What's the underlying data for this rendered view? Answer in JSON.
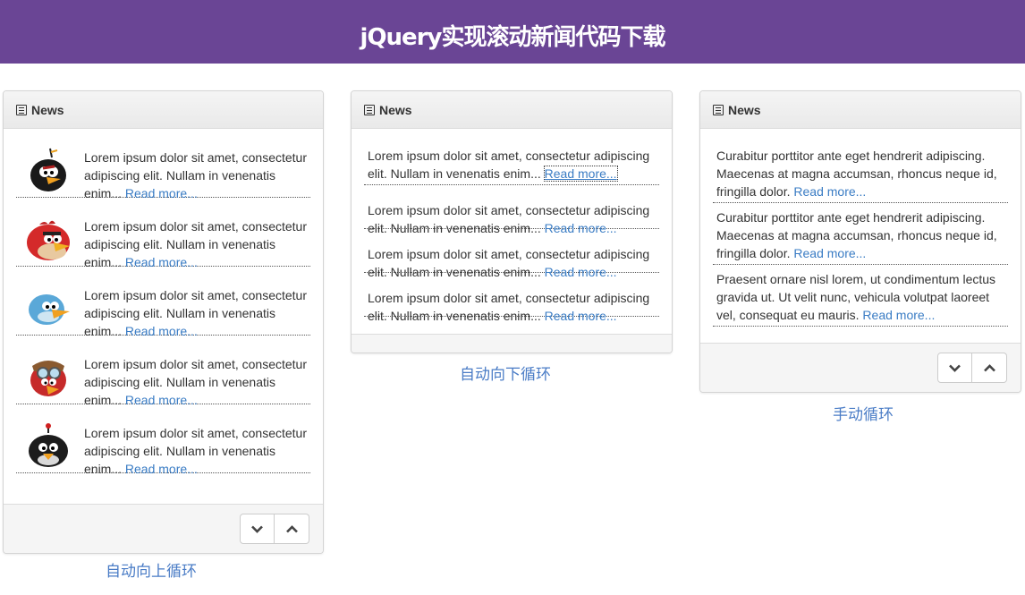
{
  "header": {
    "title": "jQuery实现滚动新闻代码下载"
  },
  "panels": [
    {
      "heading": "News",
      "caption": "自动向上循环",
      "items": [
        {
          "text": "Lorem ipsum dolor sit amet, consectetur adipiscing elit. Nullam in venenatis enim...",
          "link": "Read more...",
          "avatar": "black-bird-with-orange-beak"
        },
        {
          "text": "Lorem ipsum dolor sit amet, consectetur adipiscing elit. Nullam in venenatis enim...",
          "link": "Read more...",
          "avatar": "red-bird"
        },
        {
          "text": "Lorem ipsum dolor sit amet, consectetur adipiscing elit. Nullam in venenatis enim...",
          "link": "Read more...",
          "avatar": "blue-bird"
        },
        {
          "text": "Lorem ipsum dolor sit amet, consectetur adipiscing elit. Nullam in venenatis enim...",
          "link": "Read more...",
          "avatar": "red-bird-with-goggles"
        },
        {
          "text": "Lorem ipsum dolor sit amet, consectetur adipiscing elit. Nullam in venenatis enim...",
          "link": "Read more...",
          "avatar": "black-bomb-bird"
        }
      ]
    },
    {
      "heading": "News",
      "caption": "自动向下循环",
      "items": [
        {
          "text": "Lorem ipsum dolor sit amet, consectetur adipiscing elit. Nullam in venenatis enim...",
          "link": "Read more..."
        },
        {
          "text": "Lorem ipsum dolor sit amet, consectetur adipiscing elit. Nullam in venenatis enim...",
          "link": "Read more..."
        },
        {
          "text": "Lorem ipsum dolor sit amet, consectetur adipiscing elit. Nullam in venenatis enim...",
          "link": "Read more..."
        },
        {
          "text": "Lorem ipsum dolor sit amet, consectetur adipiscing elit. Nullam in venenatis enim...",
          "link": "Read more..."
        }
      ]
    },
    {
      "heading": "News",
      "caption": "手动循环",
      "items": [
        {
          "text": "Curabitur porttitor ante eget hendrerit adipiscing. Maecenas at magna accumsan, rhoncus neque id, fringilla dolor.",
          "link": "Read more..."
        },
        {
          "text": "Curabitur porttitor ante eget hendrerit adipiscing. Maecenas at magna accumsan, rhoncus neque id, fringilla dolor.",
          "link": "Read more..."
        },
        {
          "text": "Praesent ornare nisl lorem, ut condimentum lectus gravida ut. Ut velit nunc, vehicula volutpat laoreet vel, consequat eu mauris.",
          "link": "Read more..."
        }
      ]
    }
  ],
  "icons": {
    "heading": "list-icon",
    "down": "chevron-down-icon",
    "up": "chevron-up-icon"
  },
  "colors": {
    "topbar": "#6a4595",
    "link": "#3a7cc4",
    "caption": "#4a7cc6"
  }
}
